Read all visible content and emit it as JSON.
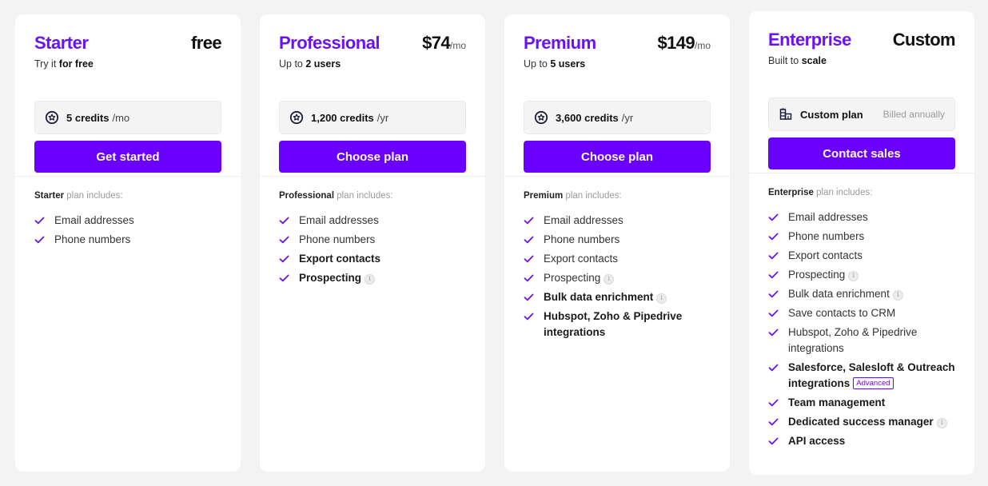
{
  "colors": {
    "accent": "#6a00ff",
    "plan_name": "#6a12f5",
    "check": "#6a12f5",
    "background": "#f3f3f3",
    "card": "#ffffff"
  },
  "plans": [
    {
      "name": "Starter",
      "price": "free",
      "price_period": "",
      "tagline_prefix": "Try it",
      "tagline_bold": "for free",
      "quota_icon": "star-badge-icon",
      "quota_bold": "5 credits",
      "quota_unit": "/mo",
      "quota_note": "",
      "cta_label": "Get started",
      "includes_bold": "Starter",
      "includes_text": "plan includes:",
      "features": [
        {
          "label": "Email addresses",
          "bold": false,
          "info": false,
          "badge": ""
        },
        {
          "label": "Phone numbers",
          "bold": false,
          "info": false,
          "badge": ""
        }
      ]
    },
    {
      "name": "Professional",
      "price": "$74",
      "price_period": "/mo",
      "tagline_prefix": "Up to",
      "tagline_bold": "2 users",
      "quota_icon": "star-badge-icon",
      "quota_bold": "1,200 credits",
      "quota_unit": "/yr",
      "quota_note": "",
      "cta_label": "Choose plan",
      "includes_bold": "Professional",
      "includes_text": "plan includes:",
      "features": [
        {
          "label": "Email addresses",
          "bold": false,
          "info": false,
          "badge": ""
        },
        {
          "label": "Phone numbers",
          "bold": false,
          "info": false,
          "badge": ""
        },
        {
          "label": "Export contacts",
          "bold": true,
          "info": false,
          "badge": ""
        },
        {
          "label": "Prospecting",
          "bold": true,
          "info": true,
          "badge": ""
        }
      ]
    },
    {
      "name": "Premium",
      "price": "$149",
      "price_period": "/mo",
      "tagline_prefix": "Up to",
      "tagline_bold": "5 users",
      "quota_icon": "star-badge-icon",
      "quota_bold": "3,600 credits",
      "quota_unit": "/yr",
      "quota_note": "",
      "cta_label": "Choose plan",
      "includes_bold": "Premium",
      "includes_text": "plan includes:",
      "features": [
        {
          "label": "Email addresses",
          "bold": false,
          "info": false,
          "badge": ""
        },
        {
          "label": "Phone numbers",
          "bold": false,
          "info": false,
          "badge": ""
        },
        {
          "label": "Export contacts",
          "bold": false,
          "info": false,
          "badge": ""
        },
        {
          "label": "Prospecting",
          "bold": false,
          "info": true,
          "badge": ""
        },
        {
          "label": "Bulk data enrichment",
          "bold": true,
          "info": true,
          "badge": ""
        },
        {
          "label": "Hubspot, Zoho & Pipedrive integrations",
          "bold": true,
          "info": false,
          "badge": ""
        }
      ]
    },
    {
      "name": "Enterprise",
      "price": "Custom",
      "price_period": "",
      "tagline_prefix": "Built to",
      "tagline_bold": "scale",
      "quota_icon": "buildings-icon",
      "quota_bold": "Custom plan",
      "quota_unit": "",
      "quota_note": "Billed annually",
      "cta_label": "Contact sales",
      "includes_bold": "Enterprise",
      "includes_text": "plan includes:",
      "features": [
        {
          "label": "Email addresses",
          "bold": false,
          "info": false,
          "badge": ""
        },
        {
          "label": "Phone numbers",
          "bold": false,
          "info": false,
          "badge": ""
        },
        {
          "label": "Export contacts",
          "bold": false,
          "info": false,
          "badge": ""
        },
        {
          "label": "Prospecting",
          "bold": false,
          "info": true,
          "badge": ""
        },
        {
          "label": "Bulk data enrichment",
          "bold": false,
          "info": true,
          "badge": ""
        },
        {
          "label": "Save contacts to CRM",
          "bold": false,
          "info": false,
          "badge": ""
        },
        {
          "label": "Hubspot, Zoho & Pipedrive integrations",
          "bold": false,
          "info": false,
          "badge": ""
        },
        {
          "label": "Salesforce, Salesloft & Outreach integrations",
          "bold": true,
          "info": false,
          "badge": "Advanced"
        },
        {
          "label": "Team management",
          "bold": true,
          "info": false,
          "badge": ""
        },
        {
          "label": "Dedicated success manager",
          "bold": true,
          "info": true,
          "badge": ""
        },
        {
          "label": "API access",
          "bold": true,
          "info": false,
          "badge": ""
        }
      ]
    }
  ]
}
